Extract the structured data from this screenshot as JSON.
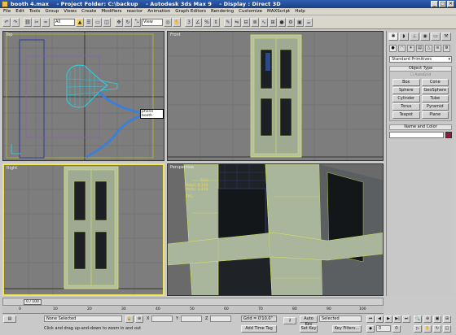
{
  "window": {
    "title": "booth 4.max    - Project Folder: C:\\backup    - Autodesk 3ds Max 9    - Display : Direct 3D",
    "minimize": "_",
    "maximize": "□",
    "close": "×"
  },
  "menu": [
    "File",
    "Edit",
    "Tools",
    "Group",
    "Views",
    "Create",
    "Modifiers",
    "reactor",
    "Animation",
    "Graph Editors",
    "Rendering",
    "Customize",
    "MAXScript",
    "Help"
  ],
  "toolbar": {
    "selection_filter": "All",
    "ref_coord": "View"
  },
  "viewports": {
    "top": {
      "label": "Top",
      "tag": "phone booth"
    },
    "front": {
      "label": "Front"
    },
    "left": {
      "label": "Right"
    },
    "perspective": {
      "label": "Perspective",
      "stats": {
        "header": "Total",
        "polys_label": "Polys:",
        "polys": "6,198",
        "verts_label": "Verts:",
        "verts": "3,448",
        "fps_label": "FPS:"
      }
    }
  },
  "command_panel": {
    "category": "Standard Primitives",
    "object_type_header": "Object Type",
    "autogrid": "AutoGrid",
    "objects": [
      "Box",
      "Cone",
      "Sphere",
      "GeoSphere",
      "Cylinder",
      "Tube",
      "Torus",
      "Pyramid",
      "Teapot",
      "Plane"
    ],
    "name_color_header": "Name and Color",
    "swatch_color": "#8b1c3a"
  },
  "timeline": {
    "frame": "0 / 100",
    "ticks": [
      "0",
      "10",
      "20",
      "30",
      "40",
      "50",
      "60",
      "70",
      "80",
      "90",
      "100"
    ]
  },
  "status": {
    "selection": "None Selected",
    "prompt": "Click and drag up-and-down to zoom in and out",
    "x_label": "X",
    "y_label": "Y",
    "z_label": "Z",
    "grid": "Grid = 0'10.0\"",
    "add_time_tag": "Add Time Tag",
    "auto_key": "Auto Key",
    "set_key": "Set Key",
    "key_mode": "Selected",
    "key_filters": "Key Filters...",
    "frame_field": "0"
  }
}
